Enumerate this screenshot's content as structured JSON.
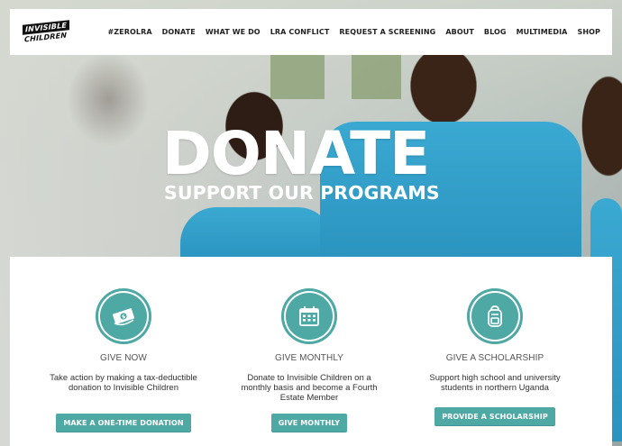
{
  "brand": {
    "logo_line1": "INVISIBLE",
    "logo_line2": "CHILDREN"
  },
  "nav": {
    "items": [
      "#ZEROLRA",
      "DONATE",
      "WHAT WE DO",
      "LRA CONFLICT",
      "REQUEST A SCREENING",
      "ABOUT",
      "BLOG",
      "MULTIMEDIA",
      "SHOP"
    ]
  },
  "hero": {
    "title": "DONATE",
    "subtitle": "SUPPORT OUR PROGRAMS"
  },
  "options": [
    {
      "icon": "money-icon",
      "title": "GIVE NOW",
      "description": "Take action by making a tax-deductible donation to Invisible Children",
      "button": "MAKE A ONE-TIME DONATION"
    },
    {
      "icon": "calendar-icon",
      "title": "GIVE MONTHLY",
      "description": "Donate to Invisible Children on a monthly basis and become a Fourth Estate Member",
      "button": "GIVE MONTHLY"
    },
    {
      "icon": "backpack-icon",
      "title": "GIVE A SCHOLARSHIP",
      "description": "Support high school and university students in northern Uganda",
      "button": "PROVIDE A SCHOLARSHIP"
    }
  ],
  "colors": {
    "accent": "#4ea8a4",
    "nav_bg": "#ffffff",
    "text": "#333333"
  }
}
